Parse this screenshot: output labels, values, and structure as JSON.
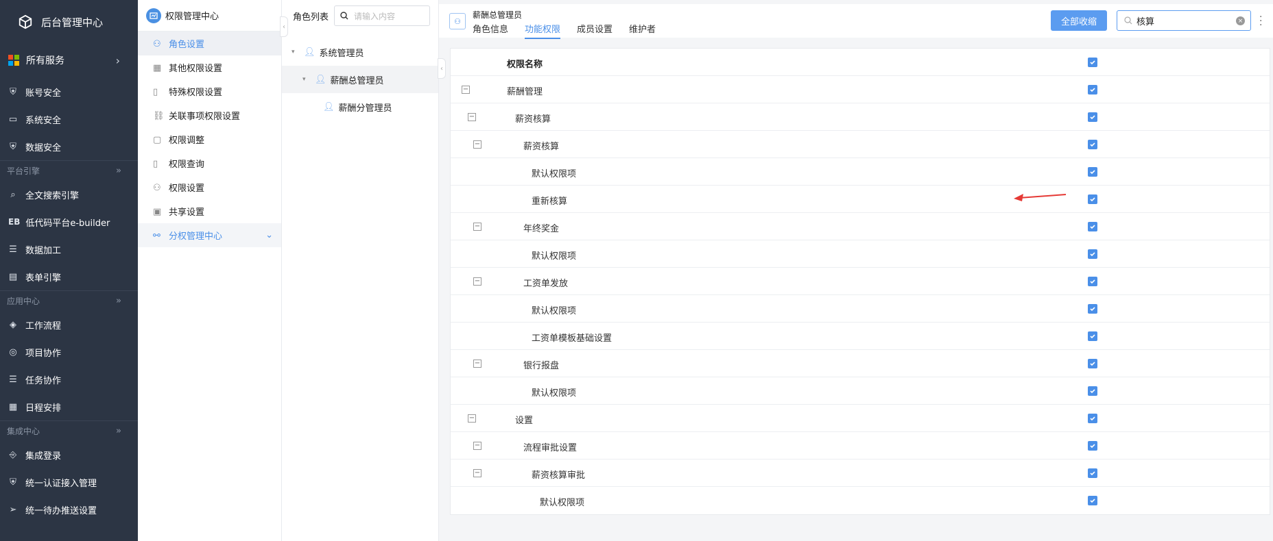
{
  "app": {
    "title": "后台管理中心"
  },
  "nav": {
    "all_services": "所有服务",
    "items_top": [
      {
        "label": "账号安全",
        "icon": "shield-icon"
      },
      {
        "label": "系统安全",
        "icon": "monitor-icon"
      },
      {
        "label": "数据安全",
        "icon": "shield-check-icon"
      }
    ],
    "group_platform": "平台引擎",
    "items_platform": [
      {
        "label": "全文搜索引擎",
        "icon": "search-icon"
      },
      {
        "label": "低代码平台e-builder",
        "icon": "eb-icon"
      },
      {
        "label": "数据加工",
        "icon": "database-icon"
      },
      {
        "label": "表单引擎",
        "icon": "form-icon"
      }
    ],
    "group_app": "应用中心",
    "items_app": [
      {
        "label": "工作流程",
        "icon": "layers-icon"
      },
      {
        "label": "项目协作",
        "icon": "compass-icon"
      },
      {
        "label": "任务协作",
        "icon": "list-icon"
      },
      {
        "label": "日程安排",
        "icon": "calendar-icon"
      }
    ],
    "group_integration": "集成中心",
    "items_integration": [
      {
        "label": "集成登录",
        "icon": "login-icon"
      },
      {
        "label": "统一认证接入管理",
        "icon": "shield-icon"
      },
      {
        "label": "统一待办推送设置",
        "icon": "send-icon"
      }
    ]
  },
  "col2": {
    "title": "权限管理中心",
    "items": [
      "角色设置",
      "其他权限设置",
      "特殊权限设置",
      "关联事项权限设置",
      "权限调整",
      "权限查询",
      "权限设置",
      "共享设置",
      "分权管理中心"
    ]
  },
  "col3": {
    "title": "角色列表",
    "search_placeholder": "请输入内容",
    "tree": [
      "系统管理员",
      "薪酬总管理员",
      "薪酬分管理员"
    ]
  },
  "main": {
    "role_name": "薪酬总管理员",
    "tabs": [
      "角色信息",
      "功能权限",
      "成员设置",
      "维护者"
    ],
    "active_tab": "功能权限",
    "collapse_all": "全部收缩",
    "search_value": "核算",
    "table_header": "权限名称",
    "rows": [
      {
        "label": "薪酬管理",
        "level": 0,
        "expandable": true
      },
      {
        "label": "薪资核算",
        "level": 1,
        "expandable": true
      },
      {
        "label": "薪资核算",
        "level": 2,
        "expandable": true
      },
      {
        "label": "默认权限项",
        "level": 3,
        "expandable": false
      },
      {
        "label": "重新核算",
        "level": 3,
        "expandable": false
      },
      {
        "label": "年终奖金",
        "level": 2,
        "expandable": true
      },
      {
        "label": "默认权限项",
        "level": 3,
        "expandable": false
      },
      {
        "label": "工资单发放",
        "level": 2,
        "expandable": true
      },
      {
        "label": "默认权限项",
        "level": 3,
        "expandable": false
      },
      {
        "label": "工资单模板基础设置",
        "level": 3,
        "expandable": false
      },
      {
        "label": "银行报盘",
        "level": 2,
        "expandable": true
      },
      {
        "label": "默认权限项",
        "level": 3,
        "expandable": false
      },
      {
        "label": "设置",
        "level": 1,
        "expandable": true
      },
      {
        "label": "流程审批设置",
        "level": 2,
        "expandable": true
      },
      {
        "label": "薪资核算审批",
        "level": 3,
        "expandable": true
      },
      {
        "label": "默认权限项",
        "level": 4,
        "expandable": false
      }
    ]
  },
  "colors": {
    "accent": "#4a8fe8",
    "sidebar": "#2c3544",
    "annotation": "#e53935"
  }
}
